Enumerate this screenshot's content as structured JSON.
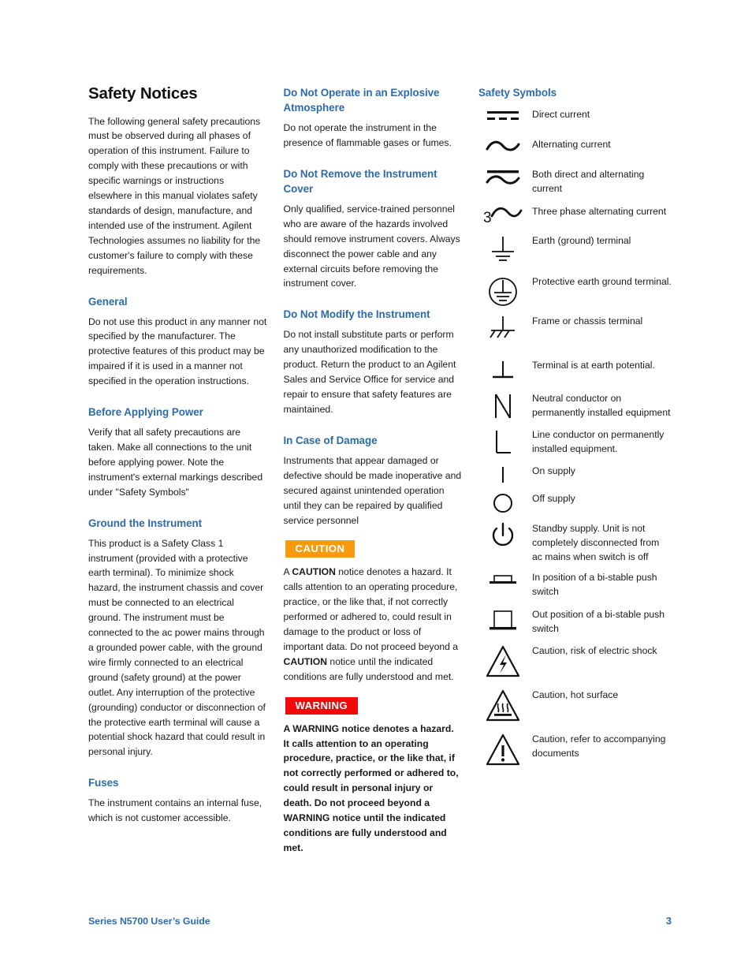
{
  "document": {
    "title": "Safety Notices",
    "footer_text": "Series N5700 User’s Guide",
    "page_number": "3",
    "accent_color": "#2E6BA8",
    "caution_color": "#F79A0E",
    "warning_color": "#F20A0A"
  },
  "column1": {
    "intro": "The following general safety precautions must be observed during all phases of operation of this instrument. Failure to comply with these precautions or with specific warnings or instructions elsewhere in this manual violates safety standards of design, manufacture, and intended use of the instrument. Agilent Technologies assumes no liability for the customer's failure to comply with these requirements.",
    "sections": [
      {
        "heading": "General",
        "body": "Do not use this product in any manner not specified by the manufacturer. The protective features of this product may be impaired if it is used in a manner not specified in the operation instructions."
      },
      {
        "heading": "Before Applying Power",
        "body": "Verify that all safety precautions are taken. Make all connections to the unit before applying power. Note the instrument's external markings described under \"Safety Symbols\""
      },
      {
        "heading": "Ground the Instrument",
        "body": "This product is a Safety Class 1 instrument (provided with a protective earth terminal). To minimize shock hazard, the instrument chassis and cover must be connected to an electrical ground.  The instrument must be connected to the ac power mains through a grounded power cable, with the ground wire firmly connected to an electrical ground (safety ground) at the power outlet. Any interruption of the protective (grounding) conductor or disconnection of the protective earth terminal will cause a potential shock hazard that could result in personal injury."
      },
      {
        "heading": "Fuses",
        "body": "The instrument contains an internal fuse, which is not customer accessible."
      }
    ]
  },
  "column2": {
    "sections": [
      {
        "heading": "Do Not Operate in an Explosive Atmosphere",
        "body": "Do not operate the instrument in the presence of flammable gases or fumes."
      },
      {
        "heading": "Do Not Remove the Instrument Cover",
        "body": "Only qualified, service-trained personnel who are aware of the hazards involved should remove instrument covers. Always disconnect the power cable and any external circuits before removing the instrument cover."
      },
      {
        "heading": "Do Not Modify the Instrument",
        "body": "Do not install substitute parts or perform any unauthorized modification to the product. Return the product to an Agilent Sales and Service Office for service and repair to ensure that safety features are maintained."
      },
      {
        "heading": "In Case of Damage",
        "body": "Instruments that appear damaged or defective should be made inoperative and secured against unintended operation until they can be repaired by qualified service personnel"
      }
    ],
    "caution_badge": "CAUTION",
    "caution_parts": {
      "p1": "A ",
      "b1": "CAUTION",
      "p2": " notice denotes a hazard. It calls attention to an operating procedure, practice, or the like that, if not correctly performed or adhered to, could result in damage to the product or loss of important data. Do not proceed beyond a ",
      "b2": "CAUTION",
      "p3": " notice until the indicated conditions are fully understood and met."
    },
    "warning_badge": "WARNING",
    "warning_body": "A WARNING notice denotes a hazard. It calls attention to an operating procedure, practice, or the like that, if not correctly performed or adhered to, could result in personal injury or death. Do not proceed beyond a WARNING notice until the indicated conditions are fully understood and met."
  },
  "column3": {
    "heading": "Safety Symbols",
    "symbols": [
      {
        "icon": "direct-current-icon",
        "label": "Direct current"
      },
      {
        "icon": "alternating-current-icon",
        "label": "Alternating current"
      },
      {
        "icon": "both-direct-and-alternating-current-icon",
        "label": "Both direct and alternating current"
      },
      {
        "icon": "three-phase-alternating-current-icon",
        "label": "Three phase alternating current"
      },
      {
        "icon": "earth-ground-terminal-icon",
        "label": "Earth (ground) terminal"
      },
      {
        "icon": "protective-earth-ground-terminal-icon",
        "label": "Protective earth ground terminal."
      },
      {
        "icon": "frame-or-chassis-terminal-icon",
        "label": "Frame or chassis terminal"
      },
      {
        "icon": "terminal-at-earth-potential-icon",
        "label": "Terminal is at earth potential."
      },
      {
        "icon": "neutral-conductor-icon",
        "label": "Neutral conductor on permanently installed equipment"
      },
      {
        "icon": "line-conductor-icon",
        "label": "Line conductor on permanently installed equipment."
      },
      {
        "icon": "on-supply-icon",
        "label": "On supply"
      },
      {
        "icon": "off-supply-icon",
        "label": "Off supply"
      },
      {
        "icon": "standby-supply-icon",
        "label": "Standby supply. Unit is not completely disconnected from ac mains when switch is off"
      },
      {
        "icon": "bistable-push-switch-in-icon",
        "label": "In position of a bi-stable push switch"
      },
      {
        "icon": "bistable-push-switch-out-icon",
        "label": "Out position of a bi-stable push switch"
      },
      {
        "icon": "electric-shock-warning-icon",
        "label": "Caution, risk of electric shock"
      },
      {
        "icon": "hot-surface-warning-icon",
        "label": "Caution, hot surface"
      },
      {
        "icon": "refer-to-documents-warning-icon",
        "label": "Caution, refer to accompanying documents"
      }
    ]
  }
}
